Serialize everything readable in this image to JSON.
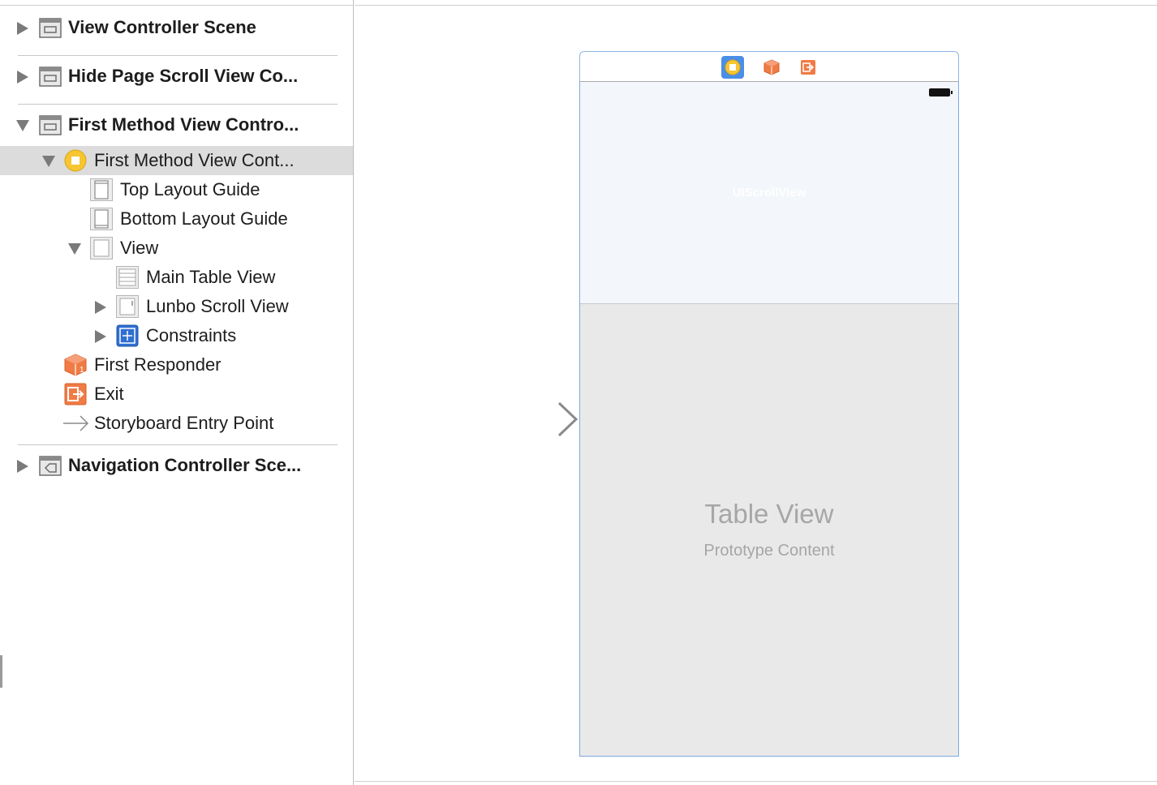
{
  "outline": {
    "items": [
      {
        "label": "View Controller Scene",
        "icon": "scene-icon"
      },
      {
        "label": "Hide Page Scroll View Co...",
        "icon": "scene-icon"
      },
      {
        "label": "First Method View Contro...",
        "icon": "scene-icon"
      },
      {
        "label": "First Method View Cont...",
        "icon": "view-controller-icon"
      },
      {
        "label": "Top Layout Guide",
        "icon": "top-layout-guide-icon"
      },
      {
        "label": "Bottom Layout Guide",
        "icon": "bottom-layout-guide-icon"
      },
      {
        "label": "View",
        "icon": "view-icon"
      },
      {
        "label": "Main Table View",
        "icon": "table-view-icon"
      },
      {
        "label": "Lunbo Scroll View",
        "icon": "scroll-view-icon"
      },
      {
        "label": "Constraints",
        "icon": "constraints-icon"
      },
      {
        "label": "First Responder",
        "icon": "first-responder-icon"
      },
      {
        "label": "Exit",
        "icon": "exit-icon"
      },
      {
        "label": "Storyboard Entry Point",
        "icon": "entry-point-arrow-icon"
      },
      {
        "label": "Navigation Controller Sce...",
        "icon": "navigation-scene-icon"
      }
    ]
  },
  "canvas": {
    "scroll_view_label": "UIScrollView",
    "table_view_title": "Table View",
    "table_view_subtitle": "Prototype Content"
  },
  "colors": {
    "selection": "#dcdcdc",
    "view_controller_yellow": "#f6c530",
    "responder_orange": "#f07b45",
    "constraints_blue": "#2f6fd1",
    "device_border": "#7ea8e3"
  }
}
